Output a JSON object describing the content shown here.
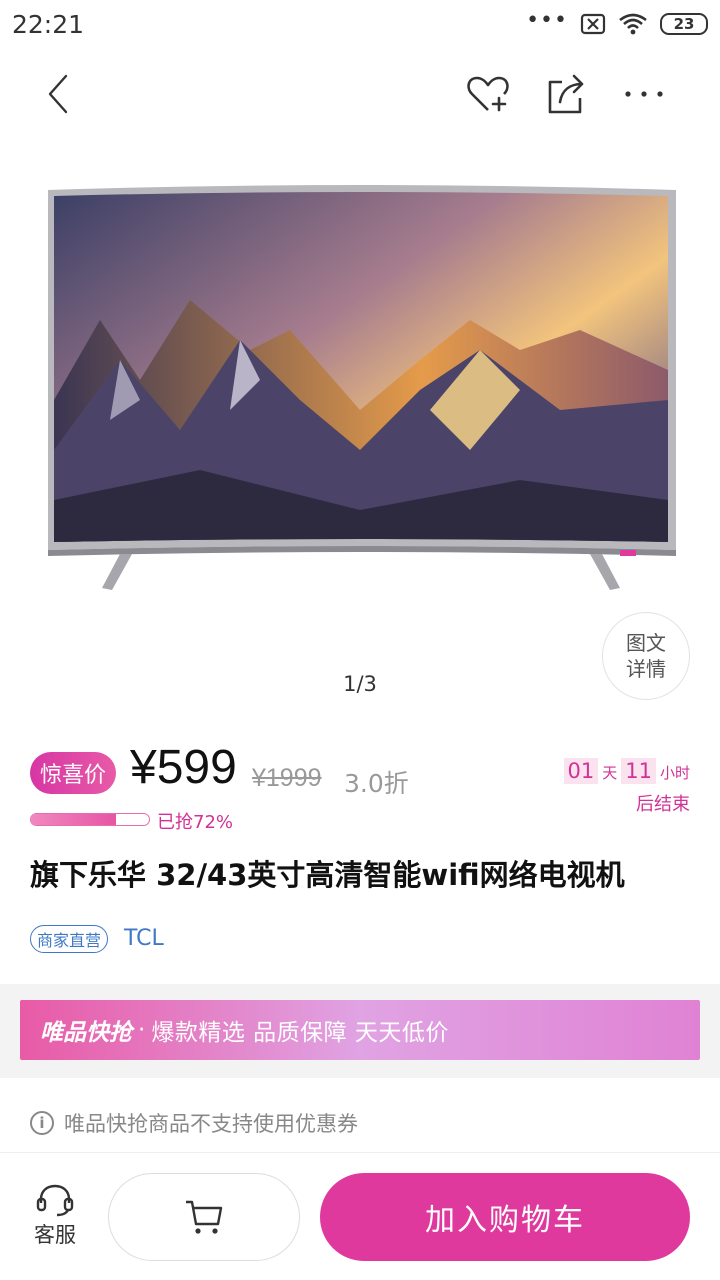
{
  "status_bar": {
    "time": "22:21",
    "dots": "•••",
    "battery": "23"
  },
  "product": {
    "image_counter": "1/3",
    "detail_button": {
      "line1": "图文",
      "line2": "详情"
    },
    "badge": "惊喜价",
    "price": "¥599",
    "original_price": "¥1999",
    "discount": "3.0折",
    "countdown": {
      "days": "01",
      "days_unit": "天",
      "hours": "11",
      "hours_unit": "小时",
      "end_text": "后结束"
    },
    "sold_progress": 0.72,
    "sold_text": "已抢72%",
    "title": "旗下乐华 32/43英寸高清智能wifi网络电视机",
    "tag": "商家直营",
    "brand": "TCL"
  },
  "promo": {
    "brand": "唯品快抢",
    "dot": "·",
    "slogan": "爆款精选 品质保障 天天低价"
  },
  "notice": {
    "icon": "i",
    "text": "唯品快抢商品不支持使用优惠券"
  },
  "bottom_bar": {
    "service_label": "客服",
    "add_to_cart": "加入购物车"
  },
  "colors": {
    "accent": "#e0399d",
    "brand_blue": "#3f79c6"
  }
}
